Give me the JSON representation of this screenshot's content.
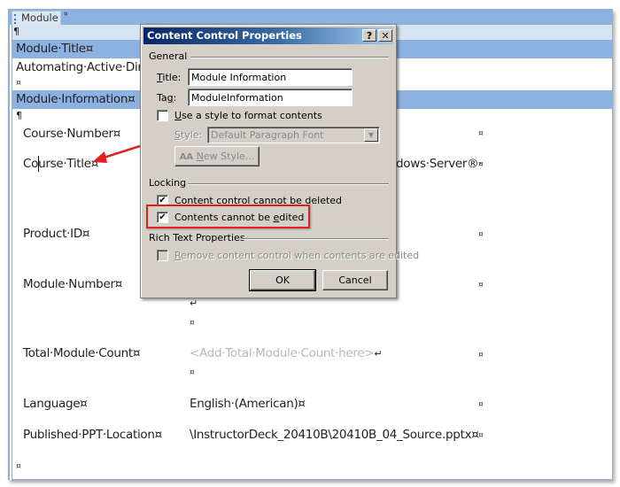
{
  "document": {
    "module_tag": "Module",
    "pilcrow": "¶",
    "cell_mark": "¤",
    "line_break": "↵",
    "rows": {
      "module_title_heading": "Module·Title¤",
      "module_title_value": "Automating·Active·Dire",
      "module_information_heading": "Module·Information¤",
      "course_number_label": "Course·Number¤",
      "course_title_label_a": "Co",
      "course_title_label_b": "urse·Title¤",
      "course_title_value_fragment": "dows·Server®·",
      "product_id_label": "Product·ID¤",
      "module_number_label": "Module·Number¤",
      "total_module_count_label": "Total·Module·Count¤",
      "total_module_count_placeholder": "<Add·Total·Module·Count·here>",
      "language_label": "Language¤",
      "language_value": "English·(American)¤",
      "published_ppt_location_label": "Published·PPT·Location¤",
      "published_ppt_location_value": "\\InstructorDeck_20410B\\20410B_04_Source.pptx¤"
    }
  },
  "dialog": {
    "title": "Content Control Properties",
    "help_button": "?",
    "close_button": "✕",
    "general_group": "General",
    "title_label_u": "T",
    "title_label_rest": "itle:",
    "title_value": "Module Information",
    "tag_label_a": "Ta",
    "tag_label_u": "g",
    "tag_label_rest": ":",
    "tag_value": "ModuleInformation",
    "use_style_u": "U",
    "use_style_rest": "se a style to format contents",
    "use_style_checked": false,
    "style_label_u": "S",
    "style_label_rest": "tyle:",
    "style_value": "Default Paragraph Font",
    "new_style_icon": "AA",
    "new_style_u": "N",
    "new_style_rest": "ew Style...",
    "locking_group": "Locking",
    "cannot_delete_label": "Content control cannot be deleted",
    "cannot_delete_checked": true,
    "cannot_edit_a": "Contents cannot be ",
    "cannot_edit_u": "e",
    "cannot_edit_rest": "dited",
    "cannot_edit_checked": true,
    "rich_text_group": "Rich Text Properties",
    "remove_cc_u": "R",
    "remove_cc_rest": "emove content control when contents are edited",
    "remove_cc_checked": false,
    "ok_button": "OK",
    "cancel_button": "Cancel",
    "checkmark": "✔"
  },
  "annotations": {
    "arrow_color": "#e02020",
    "highlight_color": "#e02020"
  }
}
